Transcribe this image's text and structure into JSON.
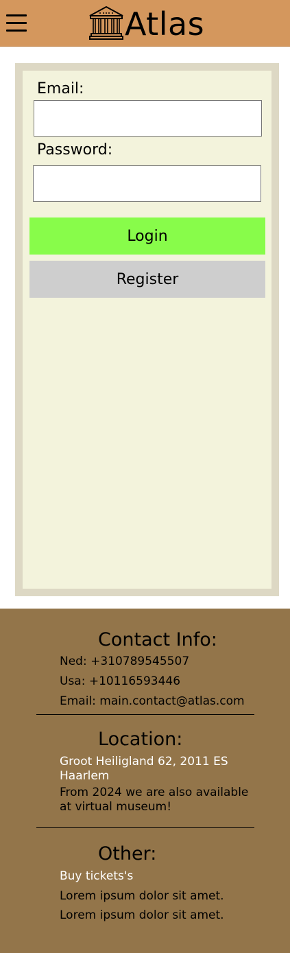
{
  "header": {
    "brand": "Atlas",
    "menu_icon": "hamburger-menu-icon",
    "logo_icon": "museum-building-icon",
    "background": "#d4975d"
  },
  "login_form": {
    "email_label": "Email:",
    "email_value": "",
    "password_label": "Password:",
    "password_value": "",
    "login_label": "Login",
    "register_label": "Register",
    "login_color": "#88fc4a",
    "register_color": "#cecece"
  },
  "footer": {
    "background": "#93754a",
    "contact": {
      "heading": "Contact Info:",
      "ned": "Ned: +310789545507",
      "usa": "Usa: +10116593446",
      "email": "Email: main.contact@atlas.com"
    },
    "location": {
      "heading": "Location:",
      "address": "Groot Heiligland 62, 2011 ES Haarlem",
      "note": "From 2024 we are also available at virtual museum!"
    },
    "other": {
      "heading": "Other:",
      "tickets": "Buy tickets's",
      "lorem1": "Lorem ipsum dolor sit amet.",
      "lorem2": "Lorem ipsum dolor sit amet."
    }
  }
}
